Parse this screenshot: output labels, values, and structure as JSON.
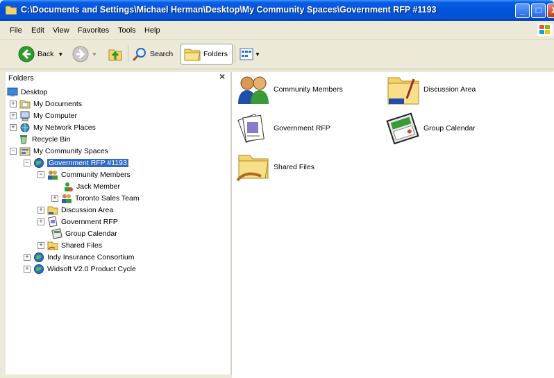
{
  "window": {
    "title": "C:\\Documents and Settings\\Michael Herman\\Desktop\\My Community Spaces\\Government RFP #1193",
    "buttons": {
      "minimize": "_",
      "maximize": "□",
      "close": "X"
    }
  },
  "menu": [
    "File",
    "Edit",
    "View",
    "Favorites",
    "Tools",
    "Help"
  ],
  "toolbar": {
    "back_label": "Back",
    "search_label": "Search",
    "folders_label": "Folders",
    "icons": [
      "back-icon",
      "forward-icon",
      "up-icon",
      "search-icon",
      "folders-icon",
      "views-icon"
    ]
  },
  "folders": {
    "title": "Folders",
    "close": "×",
    "tree": [
      {
        "label": "Desktop"
      },
      {
        "label": "My Documents"
      },
      {
        "label": "My Computer"
      },
      {
        "label": "My Network Places"
      },
      {
        "label": "Recycle Bin"
      },
      {
        "label": "My Community Spaces"
      },
      {
        "label": "Government RFP #1193"
      },
      {
        "label": "Community Members"
      },
      {
        "label": "Jack Member"
      },
      {
        "label": "Toronto Sales Team"
      },
      {
        "label": "Discussion Area"
      },
      {
        "label": "Government RFP"
      },
      {
        "label": "Group Calendar"
      },
      {
        "label": "Shared Files"
      },
      {
        "label": "Indy Insurance Consortium"
      },
      {
        "label": "Widsoft V2.0 Product Cycle"
      }
    ]
  },
  "content": {
    "items": [
      {
        "label": "Community Members",
        "icon": "people-icon"
      },
      {
        "label": "Discussion Area",
        "icon": "discussion-folder-icon"
      },
      {
        "label": "Government RFP",
        "icon": "documents-icon"
      },
      {
        "label": "Group Calendar",
        "icon": "calendar-icon"
      },
      {
        "label": "Shared Files",
        "icon": "shared-folder-icon"
      }
    ]
  },
  "colors": {
    "titlebar": "#0353d9",
    "selection": "#316ac5",
    "chrome": "#ece9d8"
  }
}
